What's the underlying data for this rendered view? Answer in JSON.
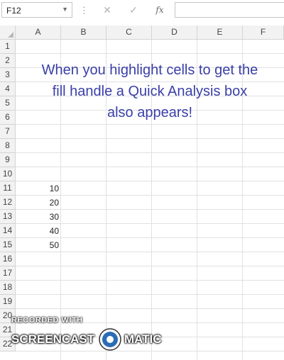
{
  "formula_bar": {
    "name_box_value": "F12",
    "separator_glyph": "⋮",
    "cancel_glyph": "✕",
    "enter_glyph": "✓",
    "function_glyph": "fx",
    "formula_value": ""
  },
  "sheet": {
    "columns": [
      "A",
      "B",
      "C",
      "D",
      "E",
      "F"
    ],
    "rows": [
      "1",
      "2",
      "3",
      "4",
      "5",
      "6",
      "7",
      "8",
      "9",
      "10",
      "11",
      "12",
      "13",
      "14",
      "15",
      "16",
      "17",
      "18",
      "19",
      "20",
      "21",
      "22"
    ],
    "cells_col_a": [
      {
        "row": "11",
        "value": "10"
      },
      {
        "row": "12",
        "value": "20"
      },
      {
        "row": "13",
        "value": "30"
      },
      {
        "row": "14",
        "value": "40"
      },
      {
        "row": "15",
        "value": "50"
      }
    ],
    "note_lines": [
      "When you highlight cells to get the",
      "fill handle a Quick Analysis box",
      "also appears!"
    ],
    "note_color": "#3a3fa8"
  },
  "watermark": {
    "small": "RECORDED WITH",
    "left": "SCREENCAST",
    "right": "MATIC"
  }
}
